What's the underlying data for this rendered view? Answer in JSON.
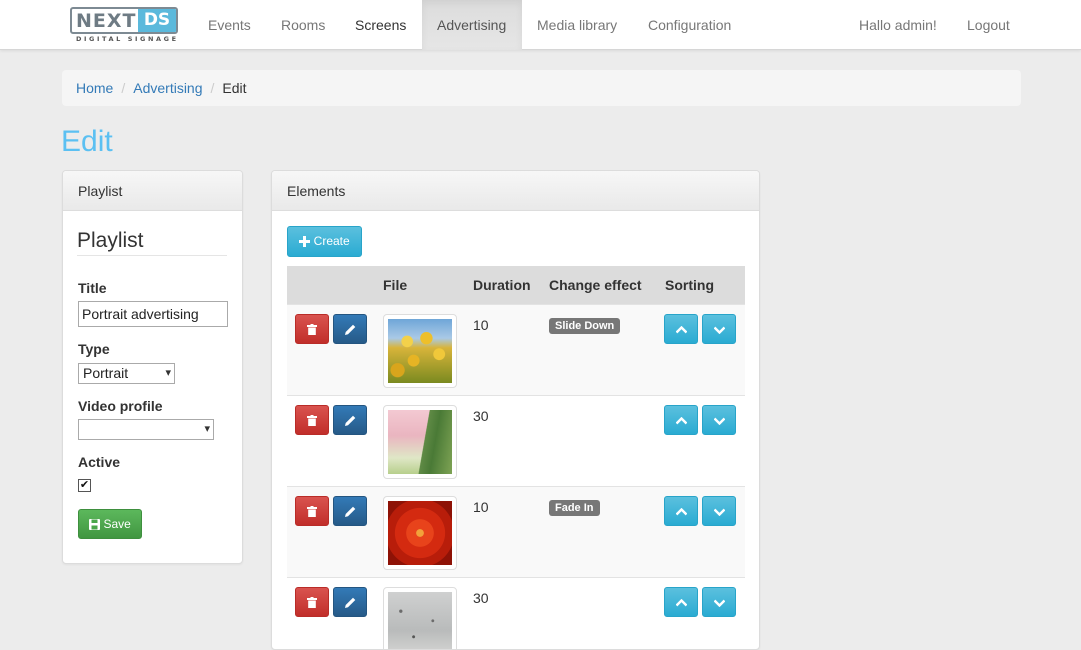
{
  "brand": {
    "name": "NEXT",
    "name_accent": "DS",
    "subtitle": "DIGITAL SIGNAGE",
    "accent_color": "#5bb9dc"
  },
  "nav": {
    "items": [
      {
        "label": "Events"
      },
      {
        "label": "Rooms"
      },
      {
        "label": "Screens"
      },
      {
        "label": "Advertising",
        "active": true
      },
      {
        "label": "Media library"
      },
      {
        "label": "Configuration"
      }
    ],
    "greeting": "Hallo admin!",
    "logout": "Logout"
  },
  "breadcrumb": {
    "home": "Home",
    "section": "Advertising",
    "current": "Edit",
    "separator": "/"
  },
  "page_title": "Edit",
  "playlist_panel": {
    "heading": "Playlist",
    "legend": "Playlist",
    "title_label": "Title",
    "title_value": "Portrait advertising",
    "type_label": "Type",
    "type_value": "Portrait",
    "video_profile_label": "Video profile",
    "video_profile_value": "",
    "active_label": "Active",
    "active_checked": true,
    "save_label": "Save"
  },
  "elements_panel": {
    "heading": "Elements",
    "create_label": "Create",
    "columns": {
      "actions": "",
      "file": "File",
      "duration": "Duration",
      "effect": "Change effect",
      "sorting": "Sorting"
    },
    "rows": [
      {
        "image": "yellow tulips",
        "duration": "10",
        "effect": "Slide Down"
      },
      {
        "image": "pink sky with trees",
        "duration": "30",
        "effect": ""
      },
      {
        "image": "red chrysanthemum",
        "duration": "10",
        "effect": "Fade In"
      },
      {
        "image": "snow landscape",
        "duration": "30",
        "effect": ""
      }
    ]
  },
  "colors": {
    "title": "#5bc0f2",
    "danger": "#d9534f",
    "primary": "#337ab7",
    "info": "#5bc0de",
    "success": "#5cb85c"
  }
}
